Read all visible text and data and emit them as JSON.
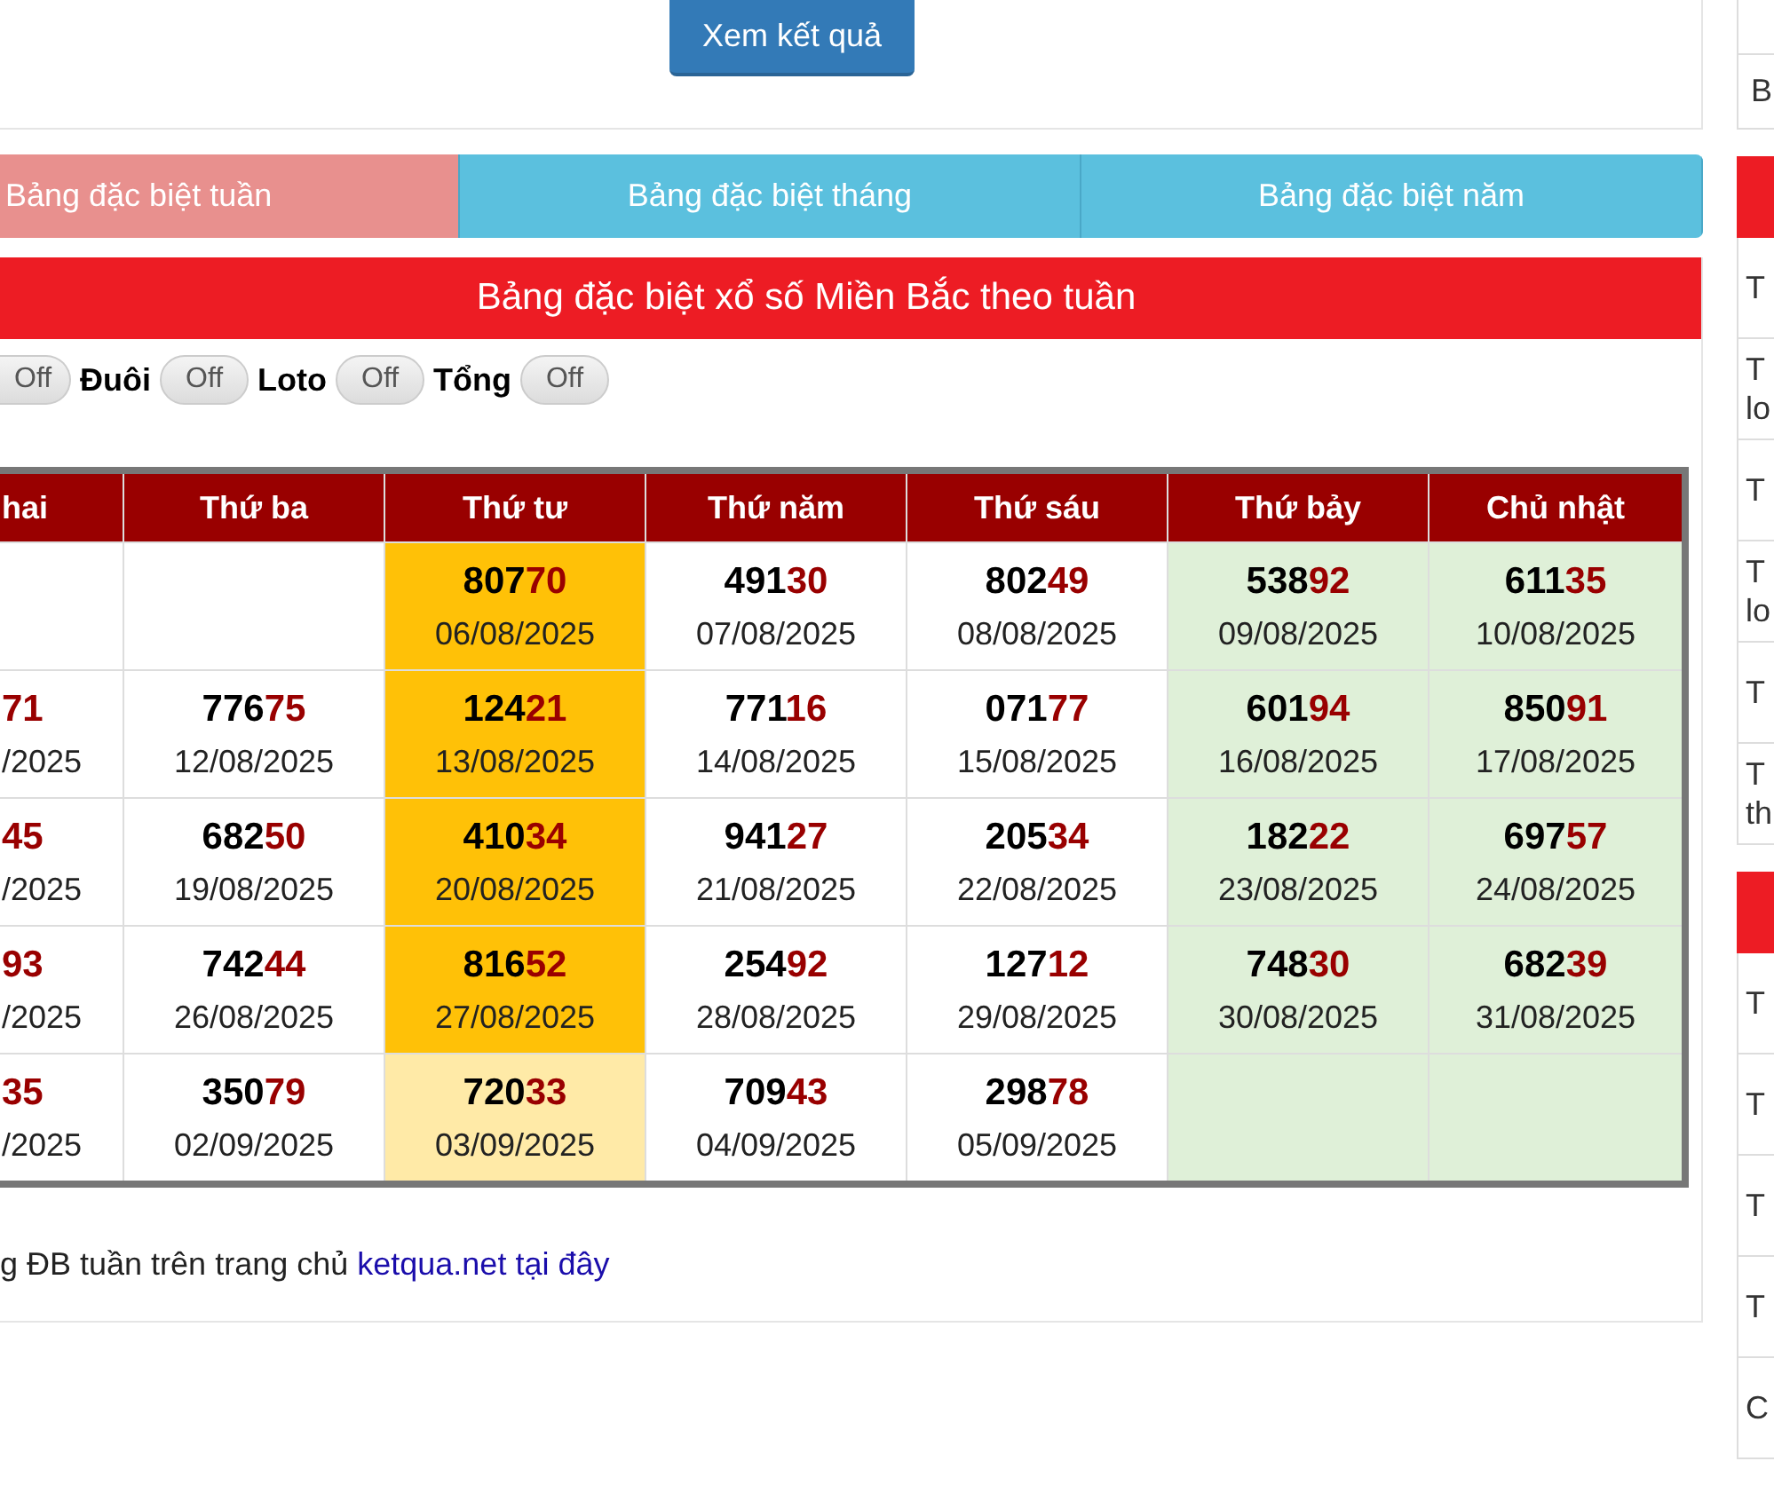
{
  "search_button": "Xem kết quả",
  "tabs": [
    {
      "label": "Bảng đặc biệt tuần",
      "selected": true
    },
    {
      "label": "Bảng đặc biệt tháng",
      "selected": false
    },
    {
      "label": "Bảng đặc biệt năm",
      "selected": false
    }
  ],
  "heading": "Bảng đặc biệt xổ số Miền Bắc theo tuần",
  "toggles": [
    {
      "on": false,
      "state_text": "Off"
    },
    {
      "label": "Đuôi",
      "on": false,
      "state_text": "Off"
    },
    {
      "label": "Loto",
      "on": false,
      "state_text": "Off"
    },
    {
      "label": "Tổng",
      "on": false,
      "state_text": "Off"
    }
  ],
  "table": {
    "columns": [
      "hai",
      "Thứ ba",
      "Thứ tư",
      "Thứ năm",
      "Thứ sáu",
      "Thứ bảy",
      "Chủ nhật"
    ],
    "rows": [
      [
        {
          "color": "#ffffff"
        },
        {
          "color": "#ffffff"
        },
        {
          "head": "807",
          "tail": "70",
          "date": "06/08/2025",
          "color": "#ffc107"
        },
        {
          "head": "491",
          "tail": "30",
          "date": "07/08/2025",
          "color": "#ffffff"
        },
        {
          "head": "802",
          "tail": "49",
          "date": "08/08/2025",
          "color": "#ffffff"
        },
        {
          "head": "538",
          "tail": "92",
          "date": "09/08/2025",
          "color": "#dff0d8"
        },
        {
          "head": "611",
          "tail": "35",
          "date": "10/08/2025",
          "color": "#dff0d8"
        }
      ],
      [
        {
          "tail": "71",
          "date": "/2025",
          "color": "#ffffff"
        },
        {
          "head": "776",
          "tail": "75",
          "date": "12/08/2025",
          "color": "#ffffff"
        },
        {
          "head": "124",
          "tail": "21",
          "date": "13/08/2025",
          "color": "#ffc107"
        },
        {
          "head": "771",
          "tail": "16",
          "date": "14/08/2025",
          "color": "#ffffff"
        },
        {
          "head": "071",
          "tail": "77",
          "date": "15/08/2025",
          "color": "#ffffff"
        },
        {
          "head": "601",
          "tail": "94",
          "date": "16/08/2025",
          "color": "#dff0d8"
        },
        {
          "head": "850",
          "tail": "91",
          "date": "17/08/2025",
          "color": "#dff0d8"
        }
      ],
      [
        {
          "tail": "45",
          "date": "/2025",
          "color": "#ffffff"
        },
        {
          "head": "682",
          "tail": "50",
          "date": "19/08/2025",
          "color": "#ffffff"
        },
        {
          "head": "410",
          "tail": "34",
          "date": "20/08/2025",
          "color": "#ffc107"
        },
        {
          "head": "941",
          "tail": "27",
          "date": "21/08/2025",
          "color": "#ffffff"
        },
        {
          "head": "205",
          "tail": "34",
          "date": "22/08/2025",
          "color": "#ffffff"
        },
        {
          "head": "182",
          "tail": "22",
          "date": "23/08/2025",
          "color": "#dff0d8"
        },
        {
          "head": "697",
          "tail": "57",
          "date": "24/08/2025",
          "color": "#dff0d8"
        }
      ],
      [
        {
          "tail": "93",
          "date": "/2025",
          "color": "#ffffff"
        },
        {
          "head": "742",
          "tail": "44",
          "date": "26/08/2025",
          "color": "#ffffff"
        },
        {
          "head": "816",
          "tail": "52",
          "date": "27/08/2025",
          "color": "#ffc107"
        },
        {
          "head": "254",
          "tail": "92",
          "date": "28/08/2025",
          "color": "#ffffff"
        },
        {
          "head": "127",
          "tail": "12",
          "date": "29/08/2025",
          "color": "#ffffff"
        },
        {
          "head": "748",
          "tail": "30",
          "date": "30/08/2025",
          "color": "#dff0d8"
        },
        {
          "head": "682",
          "tail": "39",
          "date": "31/08/2025",
          "color": "#dff0d8"
        }
      ],
      [
        {
          "tail": "35",
          "date": "/2025",
          "color": "#ffffff"
        },
        {
          "head": "350",
          "tail": "79",
          "date": "02/09/2025",
          "color": "#ffffff"
        },
        {
          "head": "720",
          "tail": "33",
          "date": "03/09/2025",
          "color": "#ffeaa7"
        },
        {
          "head": "709",
          "tail": "43",
          "date": "04/09/2025",
          "color": "#ffffff"
        },
        {
          "head": "298",
          "tail": "78",
          "date": "05/09/2025",
          "color": "#ffffff"
        },
        {
          "color": "#dff0d8"
        },
        {
          "color": "#dff0d8"
        }
      ]
    ]
  },
  "footer": {
    "text": "g ĐB tuần trên trang chủ",
    "link": "ketqua.net tại đây"
  },
  "sidebar": {
    "top_item": "B",
    "sections": [
      {
        "items": [
          "T",
          "T lo",
          "T",
          "T lo",
          "T",
          "T th"
        ]
      },
      {
        "items": [
          "T",
          "T",
          "T",
          "T",
          "C"
        ]
      }
    ]
  }
}
